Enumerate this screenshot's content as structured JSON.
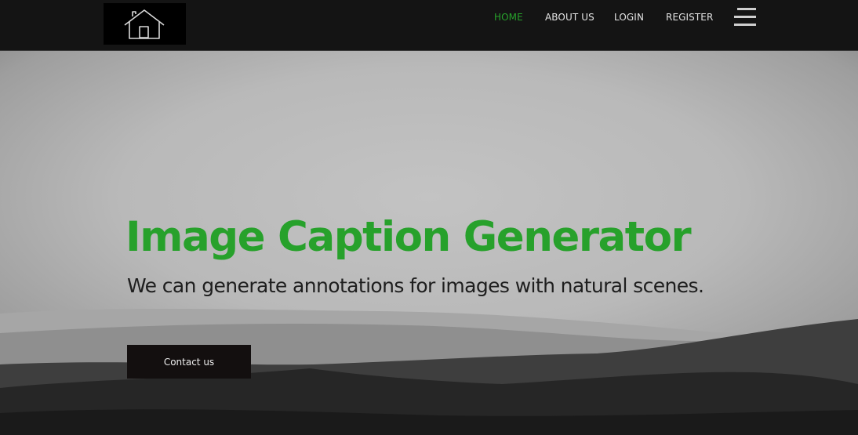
{
  "navbar": {
    "logo_icon": "house-icon",
    "links": [
      {
        "label": "HOME",
        "active": true
      },
      {
        "label": "ABOUT US",
        "active": false
      },
      {
        "label": "LOGIN",
        "active": false
      },
      {
        "label": "REGISTER",
        "active": false
      }
    ],
    "menu_icon": "hamburger-menu-icon"
  },
  "hero": {
    "title": "Image Caption Generator",
    "subtitle": "We can generate annotations for images with natural scenes.",
    "cta_label": "Contact us"
  },
  "colors": {
    "accent": "#27a12b",
    "navbar_bg": "#141414",
    "button_bg": "#130f0f"
  }
}
